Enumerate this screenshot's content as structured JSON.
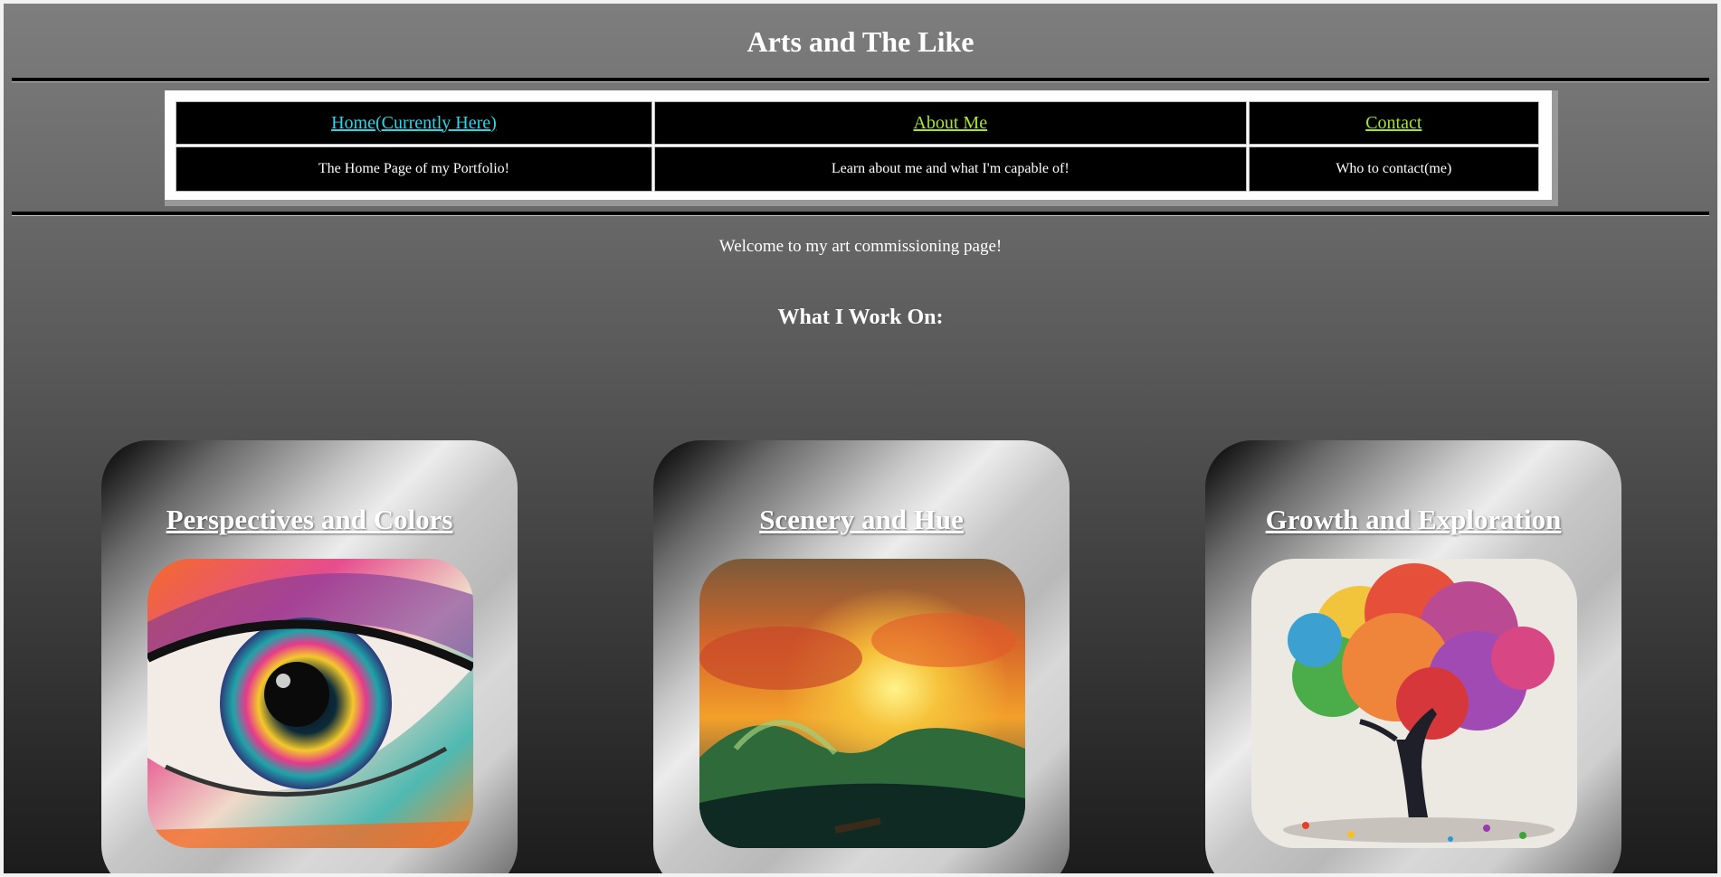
{
  "site": {
    "title": "Arts and The Like"
  },
  "nav": {
    "links": [
      {
        "label": "Home(Currently Here)",
        "color": "#27d8e8"
      },
      {
        "label": "About Me",
        "color": "#a8e62a"
      },
      {
        "label": "Contact",
        "color": "#a8e62a"
      }
    ],
    "descriptions": [
      "The Home Page of my Portfolio!",
      "Learn about me and what I'm capable of!",
      "Who to contact(me)"
    ]
  },
  "main": {
    "welcome": "Welcome to my art commissioning page!",
    "section_title": "What I Work On:",
    "cards": [
      {
        "title": "Perspectives and Colors",
        "image": "colorful-eye-painting"
      },
      {
        "title": "Scenery and Hue",
        "image": "stormy-sea-sunset-painting"
      },
      {
        "title": "Growth and Exploration",
        "image": "colorful-tree-painting"
      }
    ]
  }
}
